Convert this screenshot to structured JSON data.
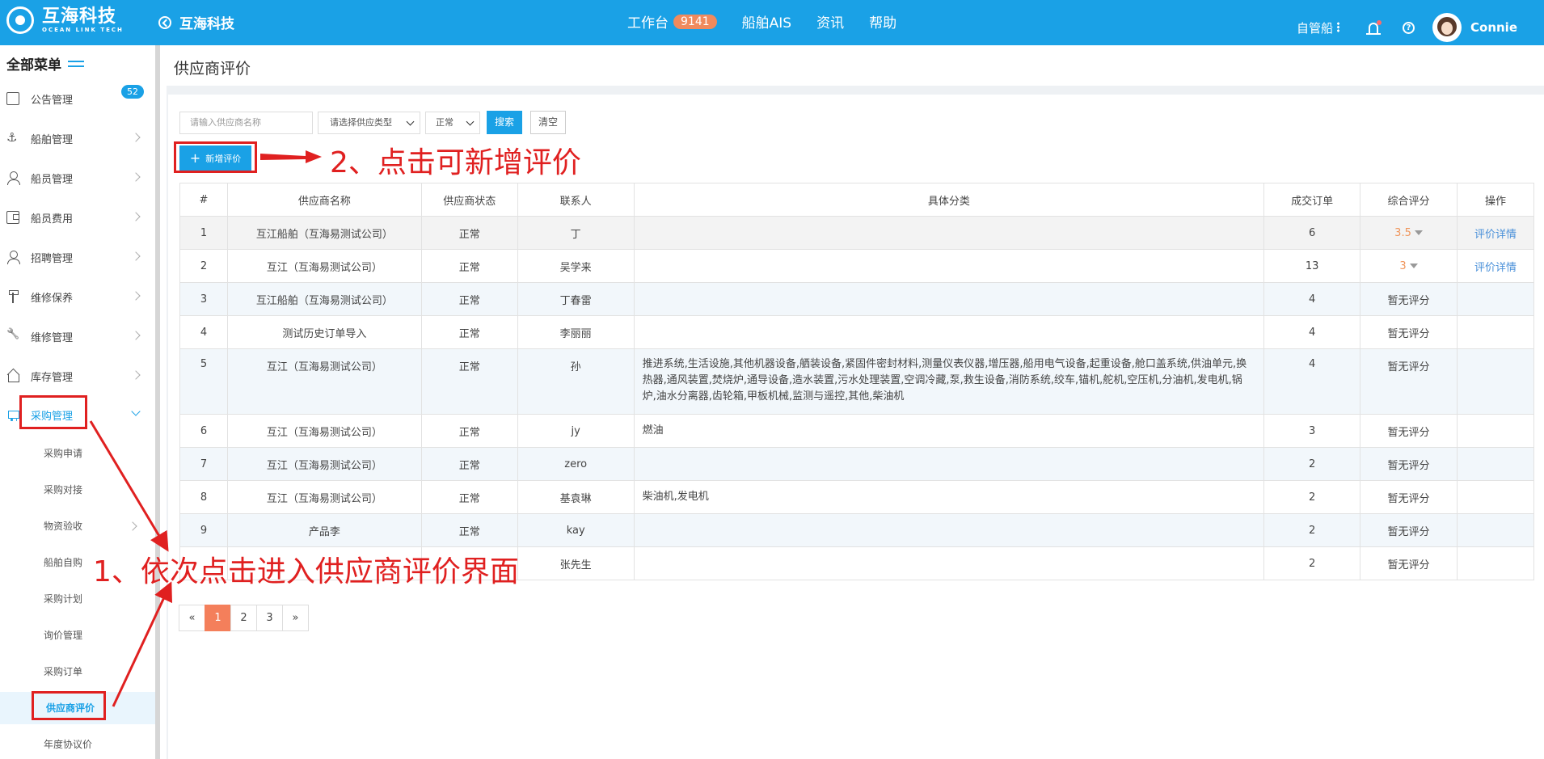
{
  "header": {
    "logo_cn": "互海科技",
    "logo_en": "OCEAN LINK TECH",
    "back_label": "互海科技",
    "nav": [
      {
        "label": "工作台",
        "badge": "9141"
      },
      {
        "label": "船舶AIS"
      },
      {
        "label": "资讯"
      },
      {
        "label": "帮助"
      }
    ],
    "mode_label": "自管船",
    "user_name": "Connie",
    "accent_color": "#1aa1e6"
  },
  "sidebar": {
    "title": "全部菜单",
    "items": [
      {
        "label": "公告管理",
        "icon": "board-icon",
        "badge": "52"
      },
      {
        "label": "船舶管理",
        "icon": "anchor-icon"
      },
      {
        "label": "船员管理",
        "icon": "user-icon"
      },
      {
        "label": "船员费用",
        "icon": "wallet-icon"
      },
      {
        "label": "招聘管理",
        "icon": "user-icon"
      },
      {
        "label": "维修保养",
        "icon": "tool-icon"
      },
      {
        "label": "维修管理",
        "icon": "wrench-icon"
      },
      {
        "label": "库存管理",
        "icon": "home-icon"
      },
      {
        "label": "采购管理",
        "icon": "cart-icon"
      }
    ],
    "sub_items": [
      {
        "label": "采购申请"
      },
      {
        "label": "采购对接"
      },
      {
        "label": "物资验收"
      },
      {
        "label": "船舶自购"
      },
      {
        "label": "采购计划"
      },
      {
        "label": "询价管理"
      },
      {
        "label": "采购订单"
      },
      {
        "label": "供应商评价"
      },
      {
        "label": "年度协议价"
      }
    ]
  },
  "page": {
    "title": "供应商评价",
    "filters": {
      "name_placeholder": "请输入供应商名称",
      "type_select": "请选择供应类型",
      "status_select": "正常",
      "search_label": "搜索",
      "clear_label": "清空"
    },
    "add_label": "新增评价"
  },
  "table": {
    "headers": [
      "#",
      "供应商名称",
      "供应商状态",
      "联系人",
      "具体分类",
      "成交订单",
      "综合评分",
      "操作"
    ],
    "rows": [
      {
        "no": "1",
        "name": "互江船舶（互海易测试公司）",
        "status": "正常",
        "contact": "丁",
        "category": "",
        "orders": "6",
        "score": "3.5",
        "action": "评价详情"
      },
      {
        "no": "2",
        "name": "互江（互海易测试公司）",
        "status": "正常",
        "contact": "吴学来",
        "category": "",
        "orders": "13",
        "score": "3",
        "action": "评价详情"
      },
      {
        "no": "3",
        "name": "互江船舶（互海易测试公司）",
        "status": "正常",
        "contact": "丁春雷",
        "category": "",
        "orders": "4",
        "score": "暂无评分",
        "action": ""
      },
      {
        "no": "4",
        "name": "测试历史订单导入",
        "status": "正常",
        "contact": "李丽丽",
        "category": "",
        "orders": "4",
        "score": "暂无评分",
        "action": ""
      },
      {
        "no": "5",
        "name": "互江（互海易测试公司）",
        "status": "正常",
        "contact": "孙",
        "category": "推进系统,生活设施,其他机器设备,舾装设备,紧固件密封材料,测量仪表仪器,增压器,船用电气设备,起重设备,舱口盖系统,供油单元,换热器,通风装置,焚烧炉,通导设备,造水装置,污水处理装置,空调冷藏,泵,救生设备,消防系统,绞车,锚机,舵机,空压机,分油机,发电机,锅炉,油水分离器,齿轮箱,甲板机械,监测与遥控,其他,柴油机",
        "orders": "4",
        "score": "暂无评分",
        "action": ""
      },
      {
        "no": "6",
        "name": "互江（互海易测试公司）",
        "status": "正常",
        "contact": "jy",
        "category": "燃油",
        "orders": "3",
        "score": "暂无评分",
        "action": ""
      },
      {
        "no": "7",
        "name": "互江（互海易测试公司）",
        "status": "正常",
        "contact": "zero",
        "category": "",
        "orders": "2",
        "score": "暂无评分",
        "action": ""
      },
      {
        "no": "8",
        "name": "互江（互海易测试公司）",
        "status": "正常",
        "contact": "基袁琳",
        "category": "柴油机,发电机",
        "orders": "2",
        "score": "暂无评分",
        "action": ""
      },
      {
        "no": "9",
        "name": "产品李",
        "status": "正常",
        "contact": "kay",
        "category": "",
        "orders": "2",
        "score": "暂无评分",
        "action": ""
      },
      {
        "no": "",
        "name": "",
        "status": "",
        "contact": "张先生",
        "category": "",
        "orders": "2",
        "score": "暂无评分",
        "action": ""
      }
    ]
  },
  "pagination": {
    "prev": "«",
    "pages": [
      "1",
      "2",
      "3"
    ],
    "current": "1",
    "next": "»"
  },
  "annotations": {
    "step1": "1、依次点击进入供应商评价界面",
    "step2": "2、点击可新增评价",
    "color": "#e02020"
  }
}
